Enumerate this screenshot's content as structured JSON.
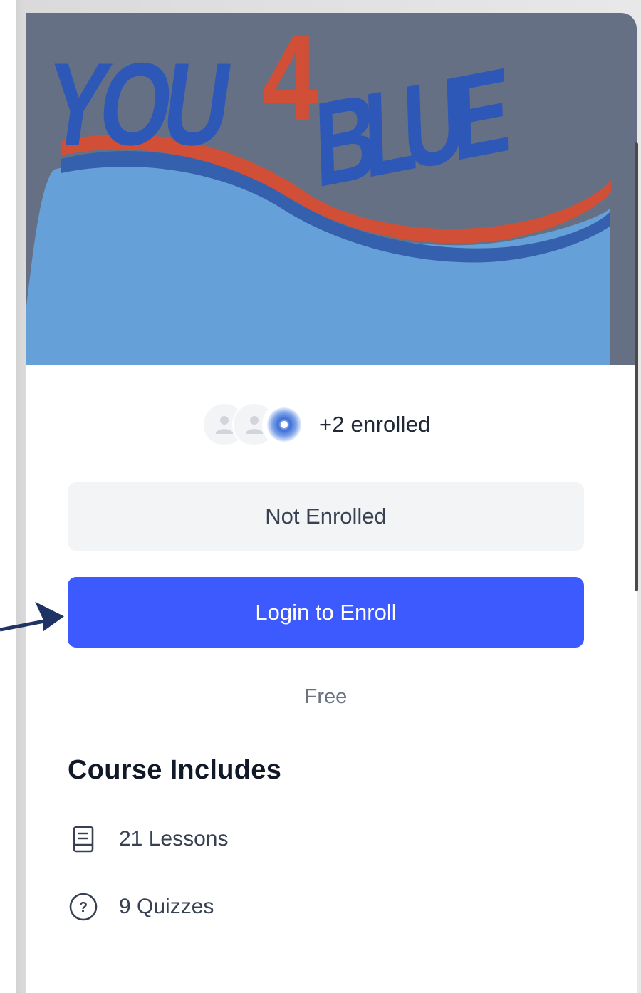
{
  "banner": {
    "logo_text_left": "YOU",
    "logo_text_number": "4",
    "logo_text_right": "BLUE",
    "colors": {
      "background": "#667085",
      "text_blue": "#2d58b8",
      "accent_red": "#d14f37",
      "wave_light": "#66a0d8",
      "wave_dark": "#3560ad"
    }
  },
  "enrollment": {
    "enrolled_count_text": "+2 enrolled",
    "avatars": [
      {
        "type": "default-user-avatar"
      },
      {
        "type": "default-user-avatar"
      },
      {
        "type": "blue-user-avatar"
      }
    ],
    "status_label": "Not Enrolled",
    "login_button_label": "Login to Enroll",
    "price_label": "Free",
    "colors": {
      "button": "#3d5afe",
      "status_bg": "#f3f4f6"
    }
  },
  "course_includes": {
    "title": "Course Includes",
    "items": [
      {
        "icon": "book-icon",
        "label": "21 Lessons"
      },
      {
        "icon": "question-circle-icon",
        "label": "9 Quizzes"
      }
    ]
  }
}
